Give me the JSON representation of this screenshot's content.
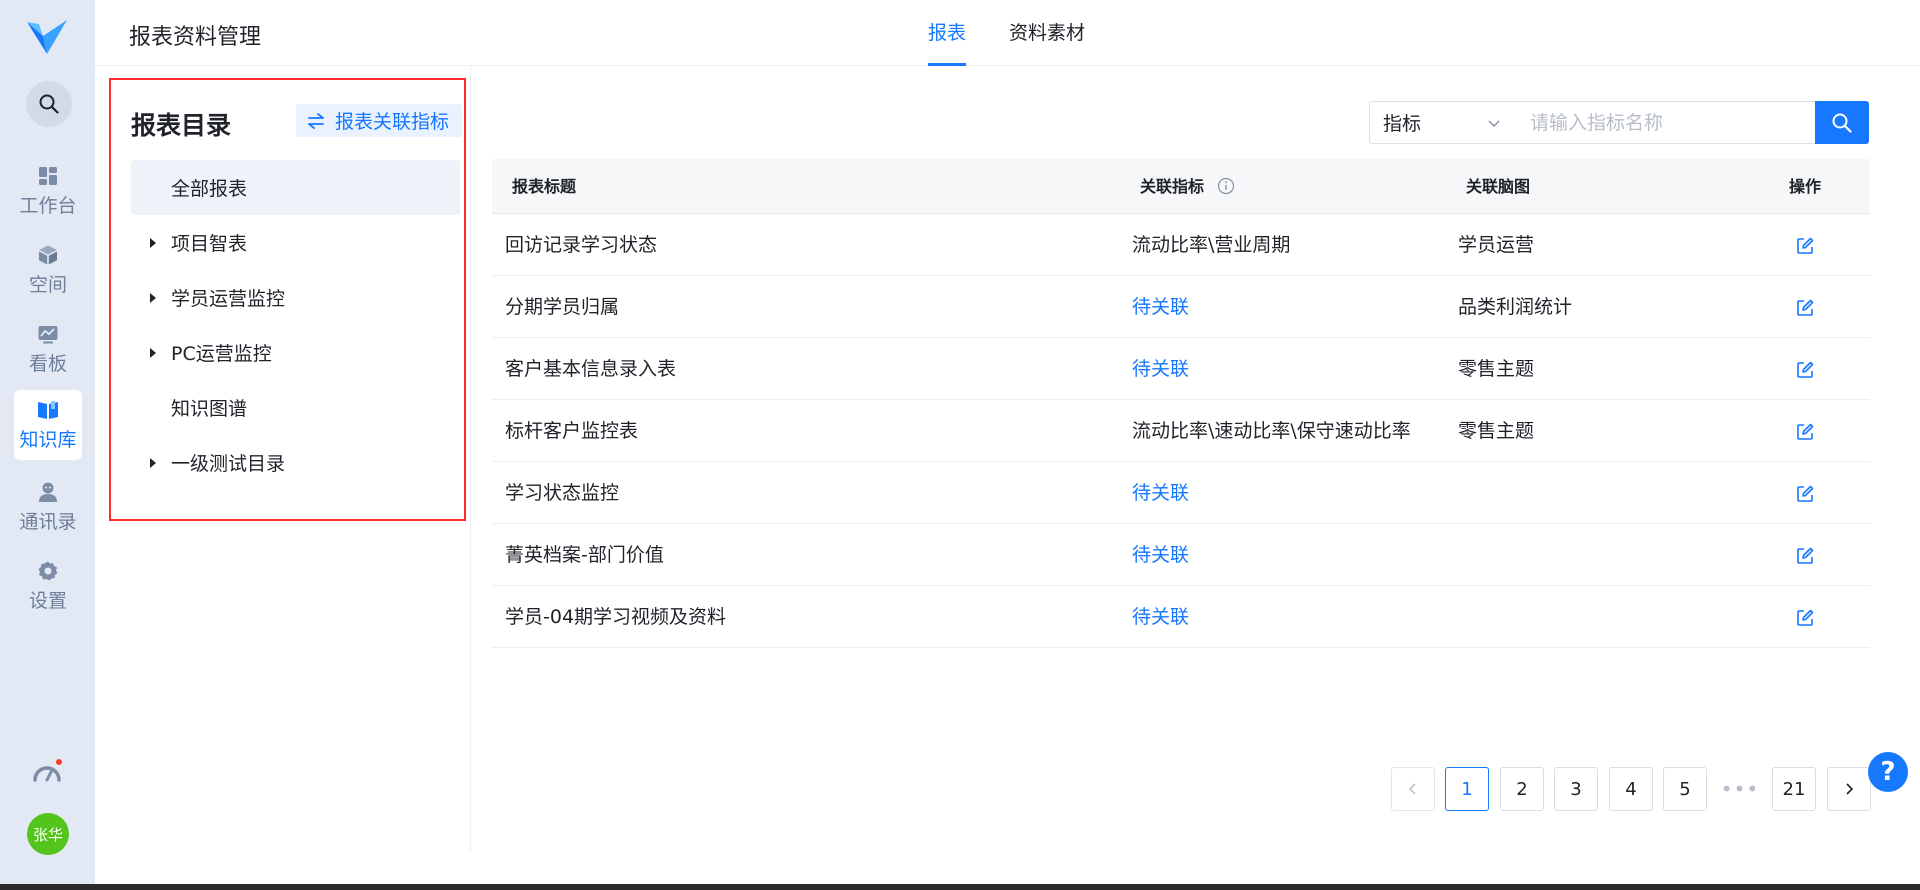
{
  "header": {
    "app_title": "报表资料管理",
    "tabs": [
      {
        "label": "报表",
        "active": true
      },
      {
        "label": "资料素材",
        "active": false
      }
    ]
  },
  "rail": {
    "nav_items": [
      {
        "label": "工作台",
        "icon": "dashboard-icon"
      },
      {
        "label": "空间",
        "icon": "cube-icon"
      },
      {
        "label": "看板",
        "icon": "chart-board-icon"
      },
      {
        "label": "知识库",
        "icon": "book-icon",
        "active": true
      },
      {
        "label": "通讯录",
        "icon": "contacts-icon"
      },
      {
        "label": "设置",
        "icon": "gear-icon"
      }
    ],
    "avatar_text": "张华"
  },
  "catalog": {
    "title": "报表目录",
    "assoc_button": "报表关联指标",
    "items": [
      {
        "label": "全部报表",
        "expandable": false,
        "selected": true
      },
      {
        "label": "项目智表",
        "expandable": true
      },
      {
        "label": "学员运营监控",
        "expandable": true
      },
      {
        "label": "PC运营监控",
        "expandable": true
      },
      {
        "label": "知识图谱",
        "expandable": false
      },
      {
        "label": "一级测试目录",
        "expandable": true
      }
    ]
  },
  "search": {
    "select_value": "指标",
    "placeholder": "请输入指标名称"
  },
  "table": {
    "headers": {
      "title": "报表标题",
      "indicator": "关联指标",
      "mindmap": "关联脑图",
      "action": "操作"
    },
    "rows": [
      {
        "title": "回访记录学习状态",
        "indicator": "流动比率\\营业周期",
        "indicator_pending": false,
        "mindmap": "学员运营"
      },
      {
        "title": "分期学员归属",
        "indicator": "待关联",
        "indicator_pending": true,
        "mindmap": "品类利润统计"
      },
      {
        "title": "客户基本信息录入表",
        "indicator": "待关联",
        "indicator_pending": true,
        "mindmap": "零售主题"
      },
      {
        "title": "标杆客户监控表",
        "indicator": "流动比率\\速动比率\\保守速动比率",
        "indicator_pending": false,
        "mindmap": "零售主题"
      },
      {
        "title": "学习状态监控",
        "indicator": "待关联",
        "indicator_pending": true,
        "mindmap": ""
      },
      {
        "title": "菁英档案-部门价值",
        "indicator": "待关联",
        "indicator_pending": true,
        "mindmap": ""
      },
      {
        "title": "学员-04期学习视频及资料",
        "indicator": "待关联",
        "indicator_pending": true,
        "mindmap": ""
      }
    ]
  },
  "pagination": {
    "current": "1",
    "pages": [
      "1",
      "2",
      "3",
      "4",
      "5"
    ],
    "ellipsis": "•••",
    "last": "21"
  },
  "help_button": "?",
  "colors": {
    "accent": "#1677ff",
    "rail_bg": "#e3e9f4",
    "highlight_border": "#ff2a2a",
    "avatar_bg": "#52c41a"
  }
}
